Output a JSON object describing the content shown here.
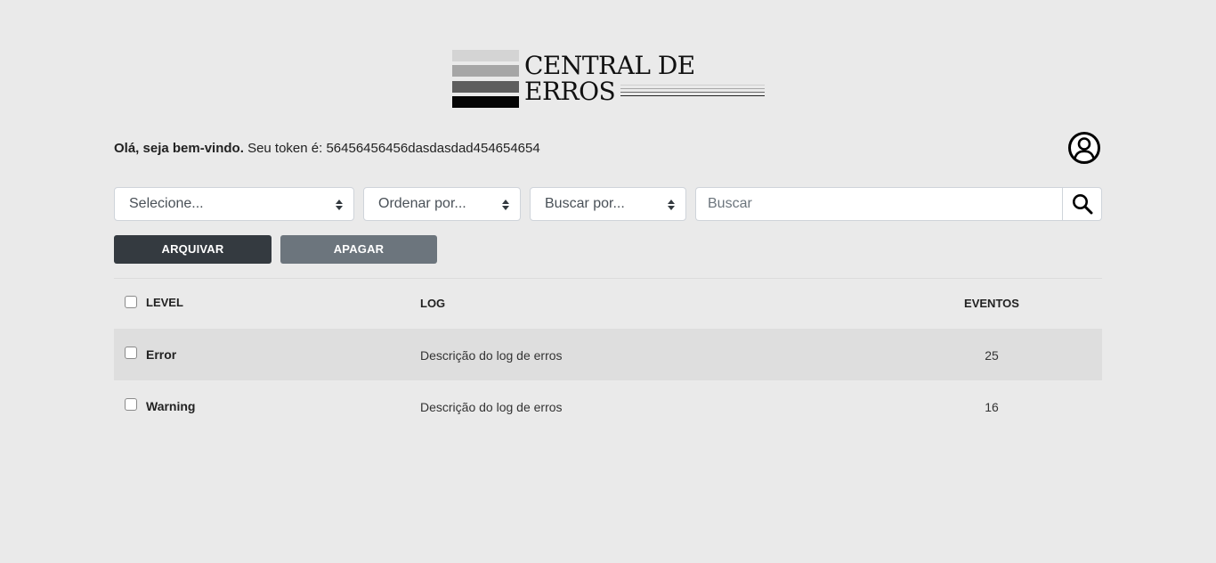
{
  "logo": {
    "line1": "CENTRAL DE",
    "line2": "ERROS"
  },
  "welcome": {
    "greeting": "Olá, seja bem-vindo.",
    "token_label": "Seu token é:",
    "token": "56456456456dasdasdad454654654"
  },
  "filters": {
    "environment_select": "Selecione...",
    "order_select": "Ordenar por...",
    "search_by_select": "Buscar por...",
    "search_placeholder": "Buscar"
  },
  "actions": {
    "archive_label": "ARQUIVAR",
    "delete_label": "APAGAR"
  },
  "table": {
    "headers": {
      "level": "LEVEL",
      "log": "LOG",
      "events": "EVENTOS"
    },
    "rows": [
      {
        "level": "Error",
        "log": "Descrição do log de erros",
        "events": "25",
        "checked": false
      },
      {
        "level": "Warning",
        "log": "Descrição do log de erros",
        "events": "16",
        "checked": false
      }
    ]
  },
  "icons": {
    "avatar": "user-circle-icon",
    "search": "search-icon"
  }
}
